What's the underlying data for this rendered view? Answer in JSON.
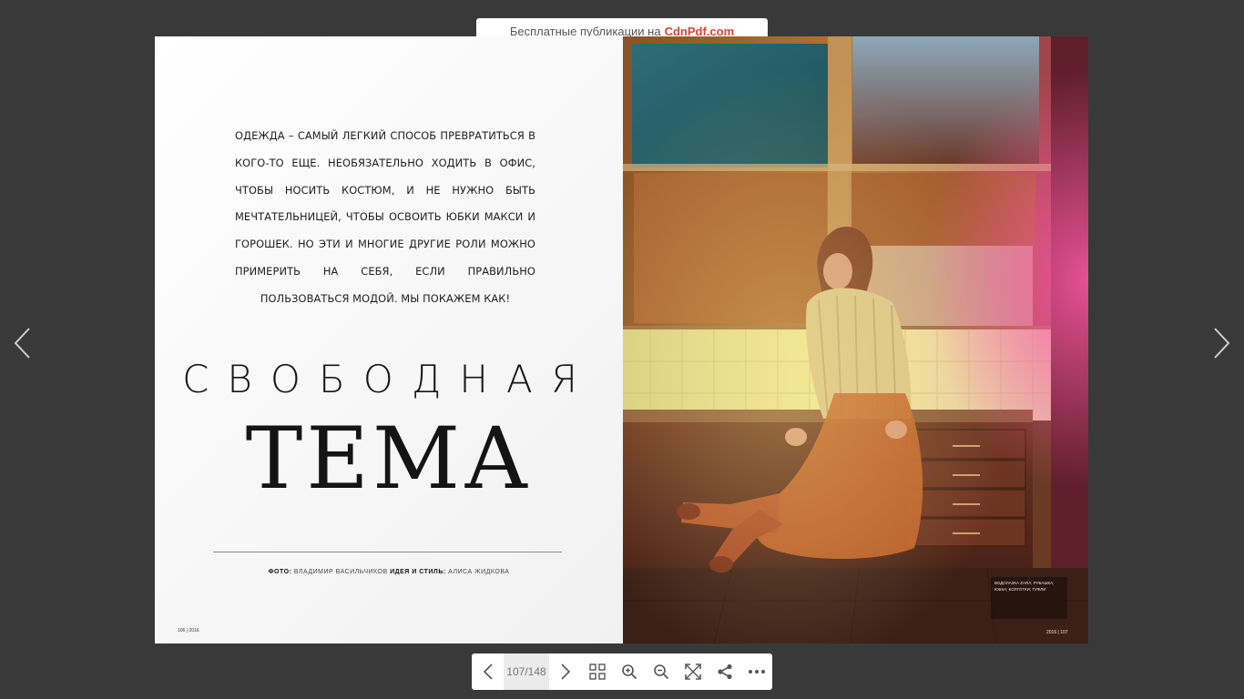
{
  "banner": {
    "text": "Бесплатные публикации на",
    "brand": "CdnPdf.com"
  },
  "nav": {
    "prev_icon": "chevron-left-icon",
    "next_icon": "chevron-right-icon"
  },
  "left_page": {
    "intro": "ОДЕЖДА – САМЫЙ ЛЕГКИЙ СПОСОБ ПРЕВРАТИТЬСЯ В КОГО-ТО ЕЩЕ. НЕОБЯЗАТЕЛЬНО ХОДИТЬ В ОФИС, ЧТОБЫ НОСИТЬ КОСТЮМ, И НЕ НУЖНО БЫТЬ МЕЧТАТЕЛЬНИЦЕЙ, ЧТОБЫ ОСВОИТЬ ЮБКИ МАКСИ И ГОРОШЕК. НО ЭТИ И МНОГИЕ ДРУГИЕ РОЛИ МОЖНО ПРИМЕРИТЬ НА СЕБЯ, ЕСЛИ ПРАВИЛЬНО ПОЛЬЗОВАТЬСЯ МОДОЙ. МЫ ПОКАЖЕМ КАК!",
    "title_top": "СВОБОДНАЯ",
    "title_main": "ТЕМА",
    "credit_photo_label": "ФОТО:",
    "credit_photo_name": "ВЛАДИМИР ВАСИЛЬЧИКОВ",
    "credit_style_label": "ИДЕЯ И СТИЛЬ:",
    "credit_style_name": "АЛИСА ЖИДКОВА",
    "folio": "106 | 2016"
  },
  "right_page": {
    "caption": "ВОДОЛАЗКА ZARA; РУБАШКА; ЮБКА; КОЛГОТКИ; ТУФЛИ",
    "folio": "2016 | 107"
  },
  "toolbar": {
    "page_indicator": "107/148",
    "icons": [
      "chevron-left-icon",
      "chevron-right-icon",
      "grid-icon",
      "zoom-in-icon",
      "zoom-out-icon",
      "fullscreen-icon",
      "share-icon",
      "more-icon"
    ]
  }
}
